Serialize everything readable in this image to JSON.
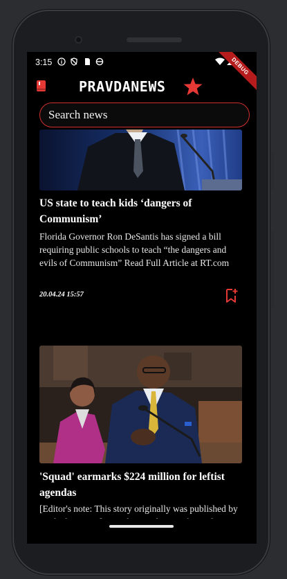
{
  "status_bar": {
    "time": "3:15",
    "icons": [
      "info-icon",
      "no-tracking-icon",
      "sim-card-icon",
      "data-saver-icon",
      "wifi-icon",
      "cellular-signal-icon",
      "battery-icon"
    ]
  },
  "debug_banner": "DEBUG",
  "app_bar": {
    "logo_text": "PRAVDANEWS",
    "menu_icon": "book-menu-icon",
    "logo_icon": "star-icon"
  },
  "search": {
    "placeholder": "Search news"
  },
  "articles": [
    {
      "title": "US state to teach kids ‘dangers of Communism’",
      "description": "Florida Governor Ron DeSantis has signed a bill requiring public schools to teach “the dangers and evils of Communism” Read Full Article at RT.com",
      "date": "20.04.24 15:57",
      "image_alt": "Man in suit at podium with microphone"
    },
    {
      "title": "'Squad' earmarks $224 million for leftist agendas",
      "description": "[Editor's note: This story originally was published by Real Clear Wire] By Adam Andrzejewski Real",
      "image_alt": "Congressman speaking at microphone in House chamber"
    }
  ],
  "colors": {
    "accent": "#e53935",
    "background": "#000000",
    "text": "#ffffff"
  }
}
